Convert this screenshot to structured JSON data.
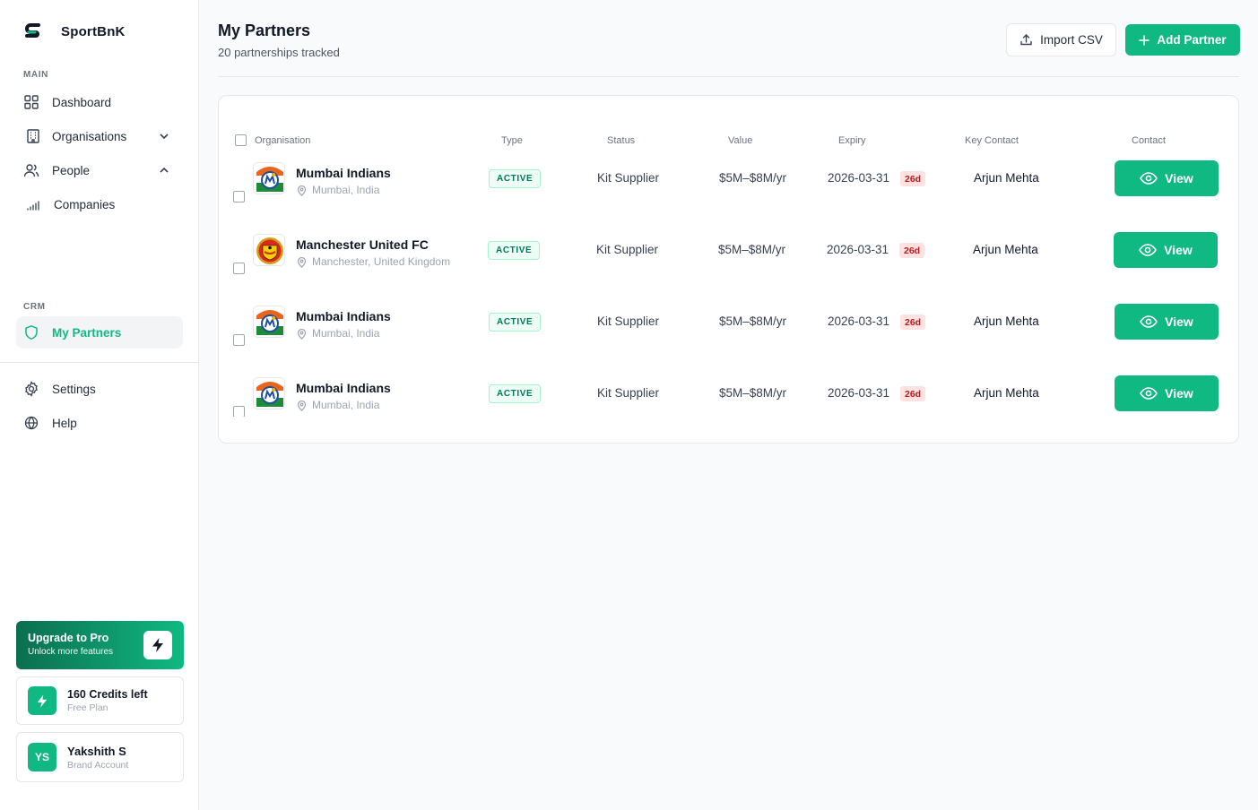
{
  "app": {
    "name": "SportBnK"
  },
  "sidebar": {
    "main_label": "MAIN",
    "crm_label": "CRM",
    "items": [
      {
        "label": "Dashboard",
        "icon": "grid-icon"
      },
      {
        "label": "Organisations",
        "icon": "building-icon",
        "chevron": "down"
      },
      {
        "label": "People",
        "icon": "users-icon",
        "chevron": "up"
      },
      {
        "label": "Companies",
        "icon": "bar-chart-icon"
      }
    ],
    "crm_items": [
      {
        "label": "My Partners",
        "icon": "shield-icon",
        "active": true
      }
    ],
    "bottom_items": [
      {
        "label": "Settings",
        "icon": "gear-icon"
      },
      {
        "label": "Help",
        "icon": "globe-icon"
      }
    ],
    "upgrade": {
      "title": "Upgrade to Pro",
      "subtitle": "Unlock more features"
    },
    "credits": {
      "title": "160 Credits left",
      "subtitle": "Free Plan"
    },
    "user": {
      "initials": "YS",
      "name": "Yakshith S",
      "role": "Brand Account"
    }
  },
  "header": {
    "title": "My Partners",
    "subtitle": "20 partnerships tracked",
    "import_label": "Import CSV",
    "add_label": "Add Partner"
  },
  "table": {
    "columns": [
      "Organisation",
      "Type",
      "Status",
      "Value",
      "Expiry",
      "Key Contact",
      "Contact"
    ],
    "rows": [
      {
        "name": "Mumbai Indians",
        "location": "Mumbai, India",
        "badge": "ACTIVE",
        "status": "Kit Supplier",
        "value": "$5M–$8M/yr",
        "expiry": "2026-03-31",
        "days": "26d",
        "contact": "Arjun Mehta",
        "action": "View",
        "logo": "mi"
      },
      {
        "name": "Manchester United FC",
        "location": "Manchester, United Kingdom",
        "badge": "ACTIVE",
        "status": "Kit Supplier",
        "value": "$5M–$8M/yr",
        "expiry": "2026-03-31",
        "days": "26d",
        "contact": "Arjun Mehta",
        "action": "View",
        "logo": "mufc"
      },
      {
        "name": "Mumbai Indians",
        "location": "Mumbai, India",
        "badge": "ACTIVE",
        "status": "Kit Supplier",
        "value": "$5M–$8M/yr",
        "expiry": "2026-03-31",
        "days": "26d",
        "contact": "Arjun Mehta",
        "action": "View",
        "logo": "mi"
      },
      {
        "name": "Mumbai Indians",
        "location": "Mumbai, India",
        "badge": "ACTIVE",
        "status": "Kit Supplier",
        "value": "$5M–$8M/yr",
        "expiry": "2026-03-31",
        "days": "26d",
        "contact": "Arjun Mehta",
        "action": "View",
        "logo": "mi"
      }
    ]
  },
  "colors": {
    "accent": "#10b981",
    "danger_bg": "#fee2e2",
    "danger_text": "#b91c1c"
  }
}
